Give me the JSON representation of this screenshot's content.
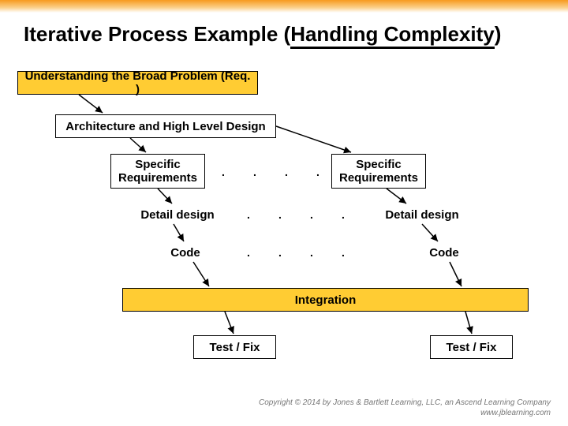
{
  "title_plain": "Iterative Process Example (",
  "title_underlined": "Handling Complexity",
  "title_close": ")",
  "boxes": {
    "req": "Understanding the Broad Problem (Req. )",
    "arch": "Architecture and High Level Design",
    "spec_left": "Specific Requirements",
    "spec_right": "Specific Requirements",
    "detail_left": "Detail design",
    "detail_right": "Detail design",
    "code_left": "Code",
    "code_right": "Code",
    "integration": "Integration",
    "test_left": "Test / Fix",
    "test_right": "Test / Fix"
  },
  "dots": ".",
  "footer": {
    "line1": "Copyright © 2014 by Jones & Bartlett Learning, LLC, an Ascend Learning Company",
    "line2": "www.jblearning.com"
  },
  "colors": {
    "highlight": "#ffcc33",
    "gradient_top": "#f79a1f"
  }
}
